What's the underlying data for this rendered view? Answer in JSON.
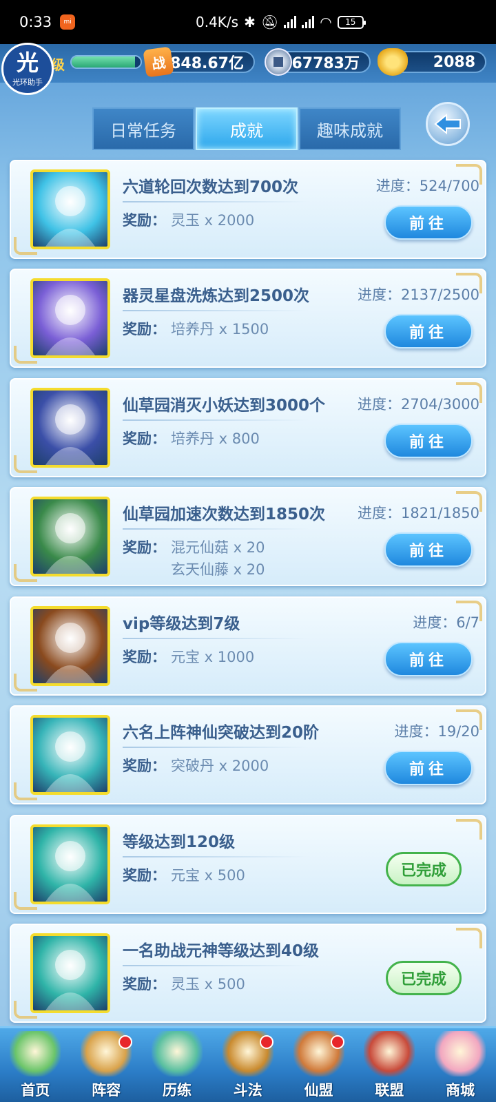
{
  "status_bar": {
    "time": "0:33",
    "network_speed": "0.4K/s",
    "battery": "15"
  },
  "logo": {
    "big": "光",
    "small": "光环助手"
  },
  "resources": {
    "level_label": "级",
    "exp_progress": 0.92,
    "power": "848.67亿",
    "power_icon": "战",
    "silver": "67783万",
    "gold": "2088"
  },
  "tabs": [
    {
      "label": "日常任务",
      "active": false
    },
    {
      "label": "成就",
      "active": true
    },
    {
      "label": "趣味成就",
      "active": false
    }
  ],
  "reward_label": "奖励：",
  "go_label": "前往",
  "done_label": "已完成",
  "tasks": [
    {
      "title": "六道轮回次数达到700次",
      "progress": "进度：524/700",
      "rewards": [
        "灵玉 x 2000"
      ],
      "status": "go",
      "avatar": "blue-ghost-avatar",
      "avatar_color": "#3fc2e6"
    },
    {
      "title": "器灵星盘洗炼达到2500次",
      "progress": "进度：2137/2500",
      "rewards": [
        "培养丹 x 1500"
      ],
      "status": "go",
      "avatar": "purple-hair-girl-avatar",
      "avatar_color": "#7a5fd6"
    },
    {
      "title": "仙草园消灭小妖达到3000个",
      "progress": "进度：2704/3000",
      "rewards": [
        "培养丹 x 800"
      ],
      "status": "go",
      "avatar": "horned-demon-avatar",
      "avatar_color": "#3b4fa8"
    },
    {
      "title": "仙草园加速次数达到1850次",
      "progress": "进度：1821/1850",
      "rewards": [
        "混元仙菇 x 20",
        "玄天仙藤 x 20"
      ],
      "status": "go",
      "avatar": "peach-tree-avatar",
      "avatar_color": "#3a8a4a"
    },
    {
      "title": "vip等级达到7级",
      "progress": "进度：6/7",
      "rewards": [
        "元宝 x 1000"
      ],
      "status": "go",
      "avatar": "star-banner-avatar",
      "avatar_color": "#8a4a1e"
    },
    {
      "title": "六名上阵神仙突破达到20阶",
      "progress": "进度：19/20",
      "rewards": [
        "突破丹 x 2000"
      ],
      "status": "go",
      "avatar": "monkey-arrow-avatar",
      "avatar_color": "#36b4b8"
    },
    {
      "title": "等级达到120级",
      "progress": "",
      "rewards": [
        "元宝 x 500"
      ],
      "status": "done",
      "avatar": "scholar-avatar",
      "avatar_color": "#2fb4a8"
    },
    {
      "title": "一名助战元神等级达到40级",
      "progress": "",
      "rewards": [
        "灵玉 x 500"
      ],
      "status": "done",
      "avatar": "scholar-avatar",
      "avatar_color": "#2fb4a8"
    }
  ],
  "bottom_nav": [
    {
      "label": "首页",
      "badge": false,
      "icon": "home-island-icon",
      "color": "#6bc56a"
    },
    {
      "label": "阵容",
      "badge": true,
      "icon": "lineup-icon",
      "color": "#d9a24a"
    },
    {
      "label": "历练",
      "badge": false,
      "icon": "gourd-icon",
      "color": "#5ac0a0"
    },
    {
      "label": "斗法",
      "badge": true,
      "icon": "sword-helmet-icon",
      "color": "#c98a2e"
    },
    {
      "label": "仙盟",
      "badge": true,
      "icon": "palace-icon",
      "color": "#d07a3a"
    },
    {
      "label": "联盟",
      "badge": false,
      "icon": "alliance-banner-icon",
      "color": "#c84a3a"
    },
    {
      "label": "商城",
      "badge": false,
      "icon": "shop-girl-icon",
      "color": "#f2a7c0"
    }
  ]
}
